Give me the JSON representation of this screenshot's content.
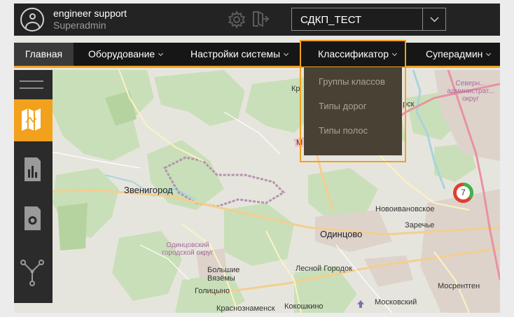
{
  "header": {
    "user_name": "engineer support",
    "user_role": "Superadmin",
    "project_select": {
      "value": "СДКП_ТЕСТ"
    },
    "icons": [
      "user-avatar-icon",
      "gear-icon",
      "exit-icon",
      "chevron-down-icon"
    ]
  },
  "nav": {
    "items": [
      {
        "label": "Главная",
        "active": true
      },
      {
        "label": "Оборудование",
        "has_dropdown": true
      },
      {
        "label": "Настройки системы",
        "has_dropdown": true
      },
      {
        "label": "Классификатор",
        "has_dropdown": true,
        "open": true
      },
      {
        "label": "Суперадмин",
        "has_dropdown": true
      }
    ]
  },
  "dropdown": {
    "items": [
      "Группы классов",
      "Типы дорог",
      "Типы полос"
    ]
  },
  "sidebar": {
    "items": [
      "menu-icon",
      "map-icon",
      "report-icon",
      "sim-card-icon",
      "network-icon"
    ],
    "active": "map-icon"
  },
  "map": {
    "labels": {
      "zvenigorod": "Звенигород",
      "odintsovo": "Одинцово",
      "novoivanovskoe": "Новоивановское",
      "zarechye": "Заречье",
      "lesnoy_gorodok": "Лесной Городок",
      "bolshie_vyazyomy": "Большие Вязёмы",
      "golitsyno": "Голицыно",
      "krasnoznamensk": "Краснознаменск",
      "kokoshkino": "Кокошкино",
      "moskovsky": "Московский",
      "mosrentgen": "Мосрентген",
      "odintsovsky_okrug": "Одинцовский городской округ",
      "severny_okrug": "Северн... администрат... округ",
      "partial_rsk": "рск",
      "partial_kr": "Кр",
      "partial_m": "М"
    },
    "cluster_count": "7"
  },
  "colors": {
    "accent": "#f2a11c",
    "header_bg": "#232323",
    "nav_bg": "#161616",
    "dropdown_bg": "#4a4135",
    "cluster_green": "#3fb34a",
    "cluster_red": "#e0402e"
  }
}
